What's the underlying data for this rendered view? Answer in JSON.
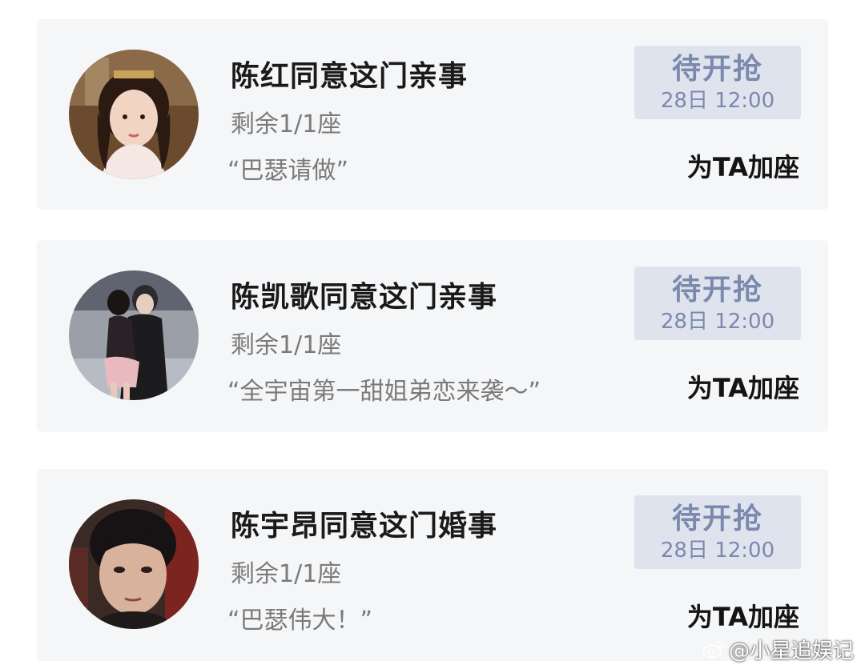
{
  "cards": [
    {
      "title": "陈红同意这门亲事",
      "seats": "剩余1/1座",
      "quote": "“巴瑟请做”",
      "button_label": "待开抢",
      "button_time": "28日 12:00",
      "add_seat": "为TA加座",
      "avatar_icon": "avatar-photo"
    },
    {
      "title": "陈凯歌同意这门亲事",
      "seats": "剩余1/1座",
      "quote": "“全宇宙第一甜姐弟恋来袭～”",
      "button_label": "待开抢",
      "button_time": "28日 12:00",
      "add_seat": "为TA加座",
      "avatar_icon": "avatar-photo"
    },
    {
      "title": "陈宇昂同意这门婚事",
      "seats": "剩余1/1座",
      "quote": "“巴瑟伟大！”",
      "button_label": "待开抢",
      "button_time": "28日 12:00",
      "add_seat": "为TA加座",
      "avatar_icon": "avatar-photo"
    }
  ],
  "watermark": {
    "text": "@小星追娱记",
    "icon": "weibo-icon"
  },
  "colors": {
    "card_bg": "#f5f6f8",
    "button_bg": "#dfe3ee",
    "button_text": "#7b89ad",
    "secondary_text": "#7a7a7a"
  }
}
